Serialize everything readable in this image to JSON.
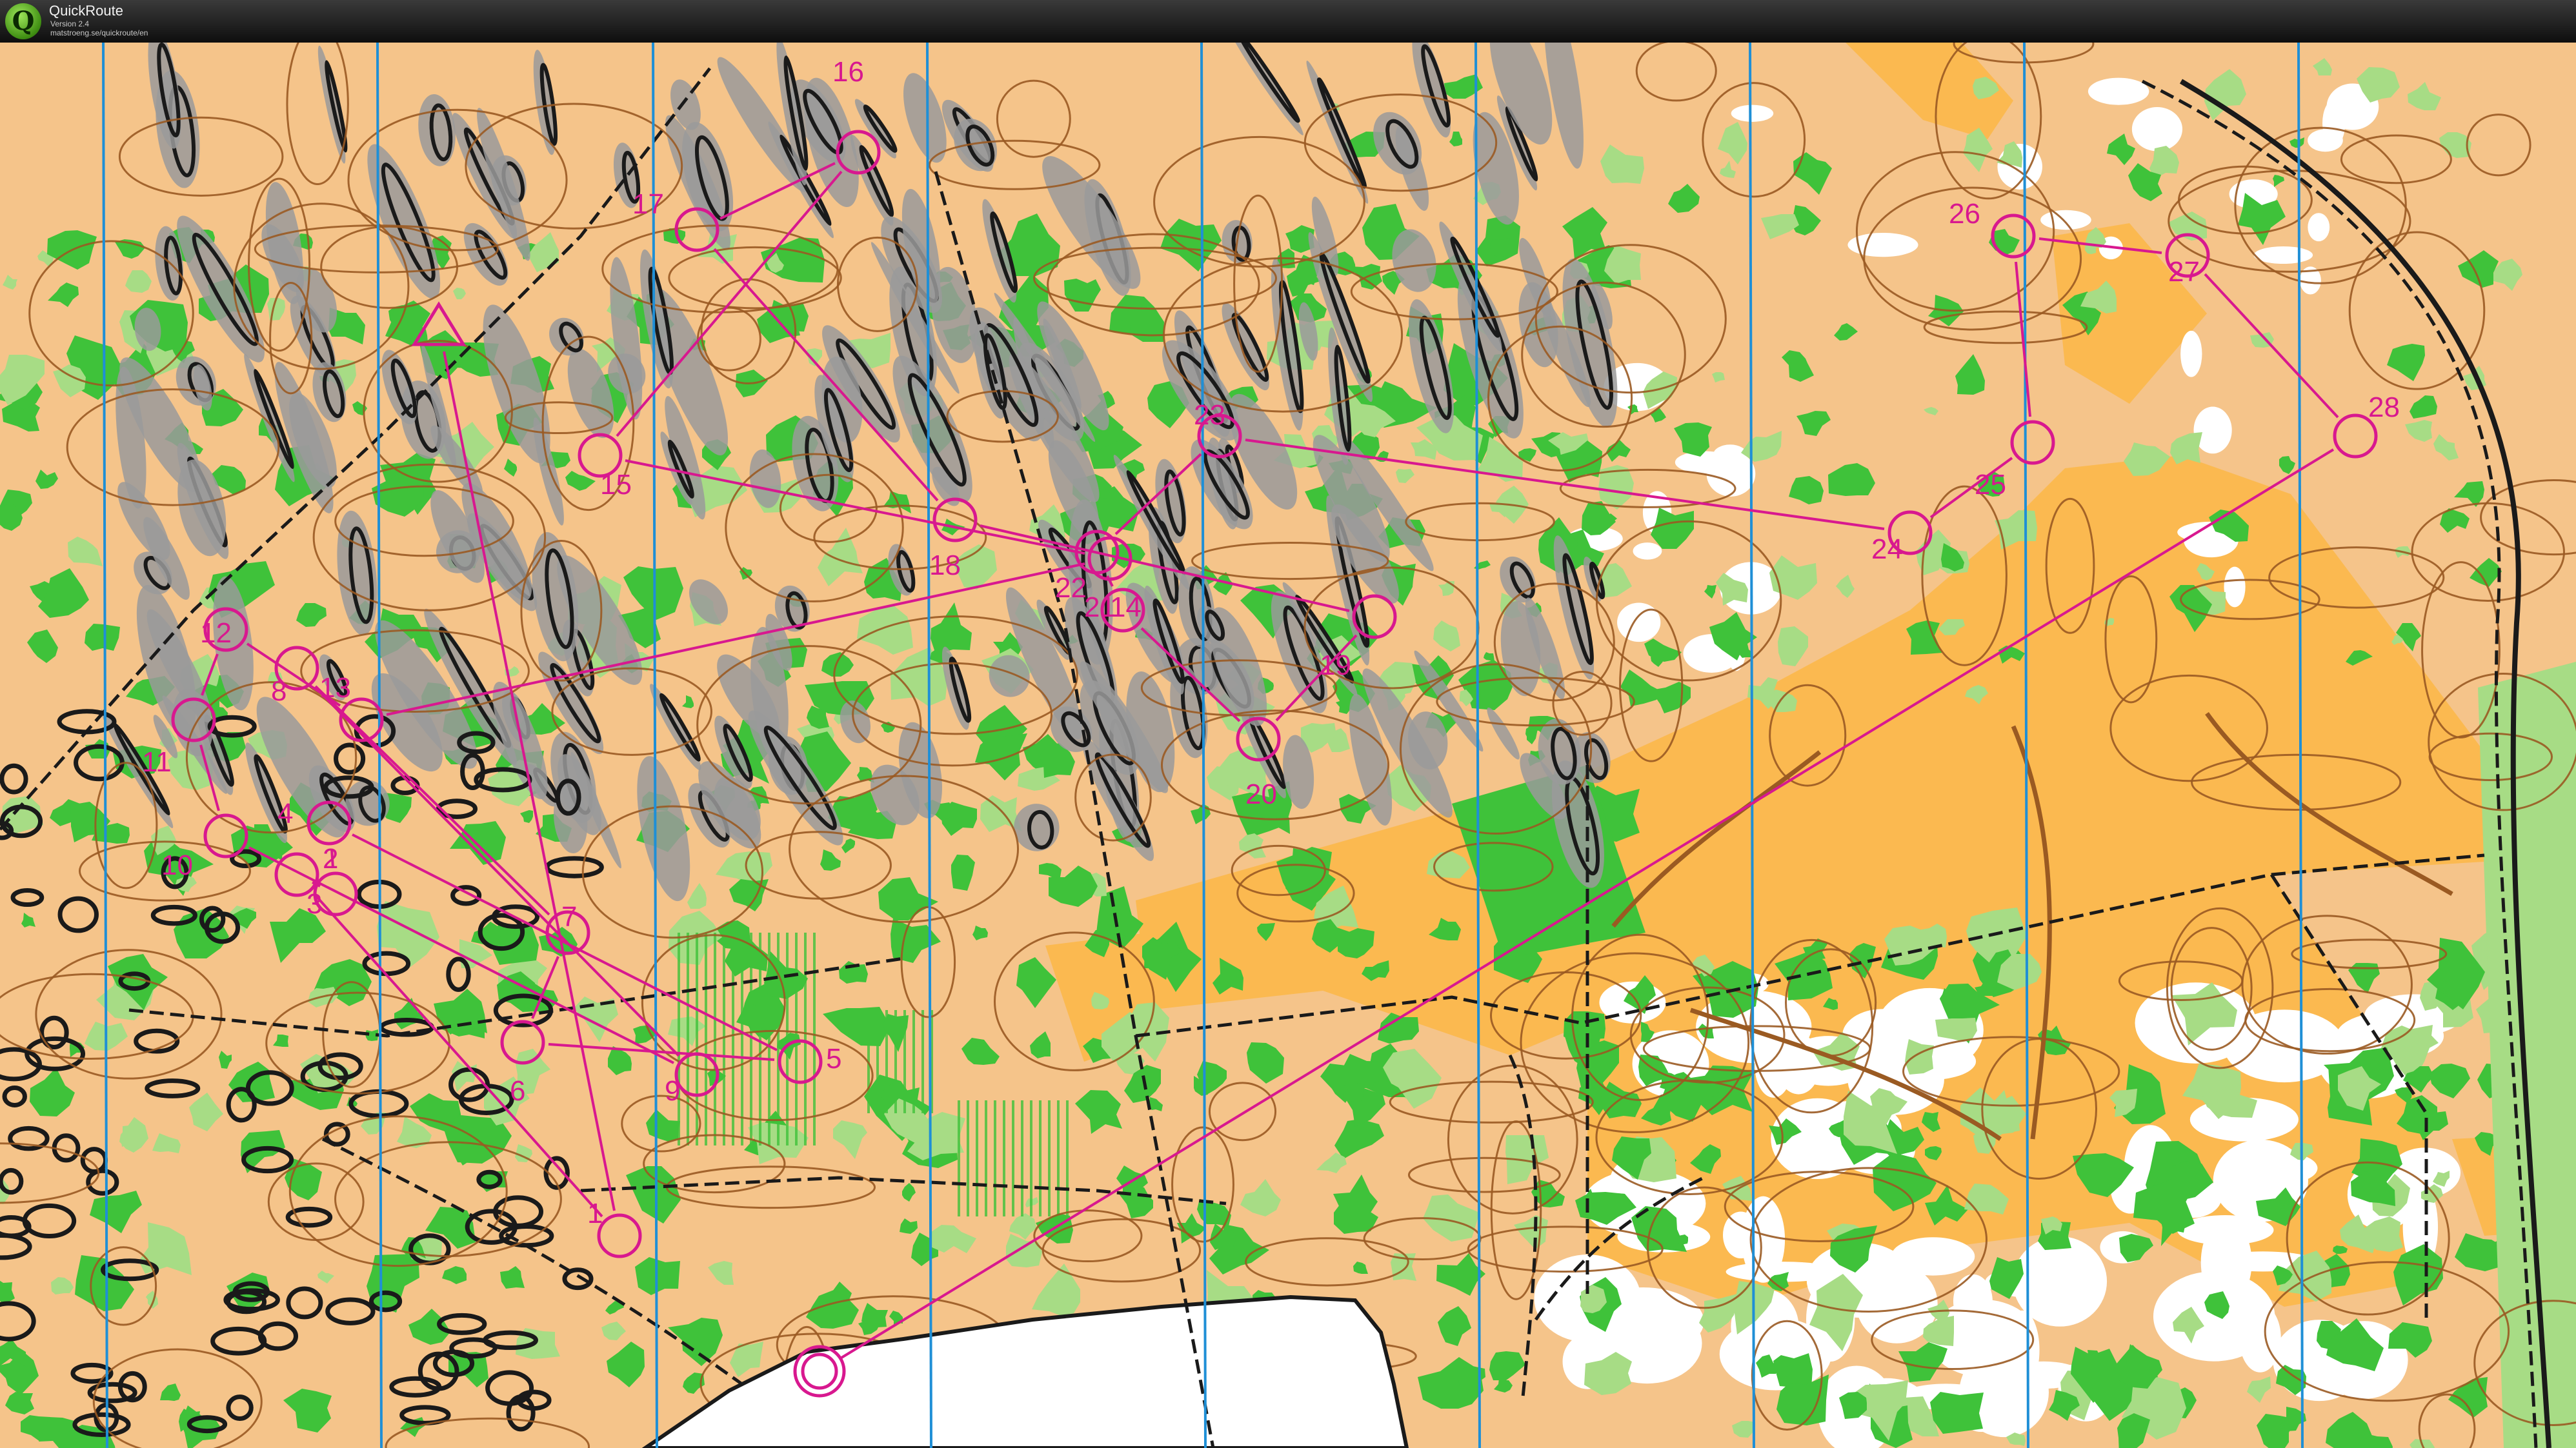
{
  "app": {
    "name": "QuickRoute",
    "version": "Version 2.4",
    "url": "matstroeng.se/quickroute/en"
  },
  "map": {
    "colors": {
      "open_land": "#f5c48a",
      "rough_open": "#fbb950",
      "forest": "#ffffff",
      "green_dense": "#3fc23a",
      "green_light": "#a7dc85",
      "rock": "#9a9a9a",
      "contour": "#9a5a22",
      "water": "#ffffff",
      "course": "#d8188f",
      "north_lines": "#1f8fd6"
    },
    "controls": [
      {
        "label": "1"
      },
      {
        "label": "2"
      },
      {
        "label": "3"
      },
      {
        "label": "4"
      },
      {
        "label": "5"
      },
      {
        "label": "6"
      },
      {
        "label": "7"
      },
      {
        "label": "8"
      },
      {
        "label": "9"
      },
      {
        "label": "10"
      },
      {
        "label": "11"
      },
      {
        "label": "12"
      },
      {
        "label": "13"
      },
      {
        "label": "14"
      },
      {
        "label": "15"
      },
      {
        "label": "16"
      },
      {
        "label": "17"
      },
      {
        "label": "18"
      },
      {
        "label": "19"
      },
      {
        "label": "20"
      },
      {
        "label": "21"
      },
      {
        "label": "22"
      },
      {
        "label": "23"
      },
      {
        "label": "24"
      },
      {
        "label": "25"
      },
      {
        "label": "26"
      },
      {
        "label": "27"
      },
      {
        "label": "28"
      }
    ]
  }
}
